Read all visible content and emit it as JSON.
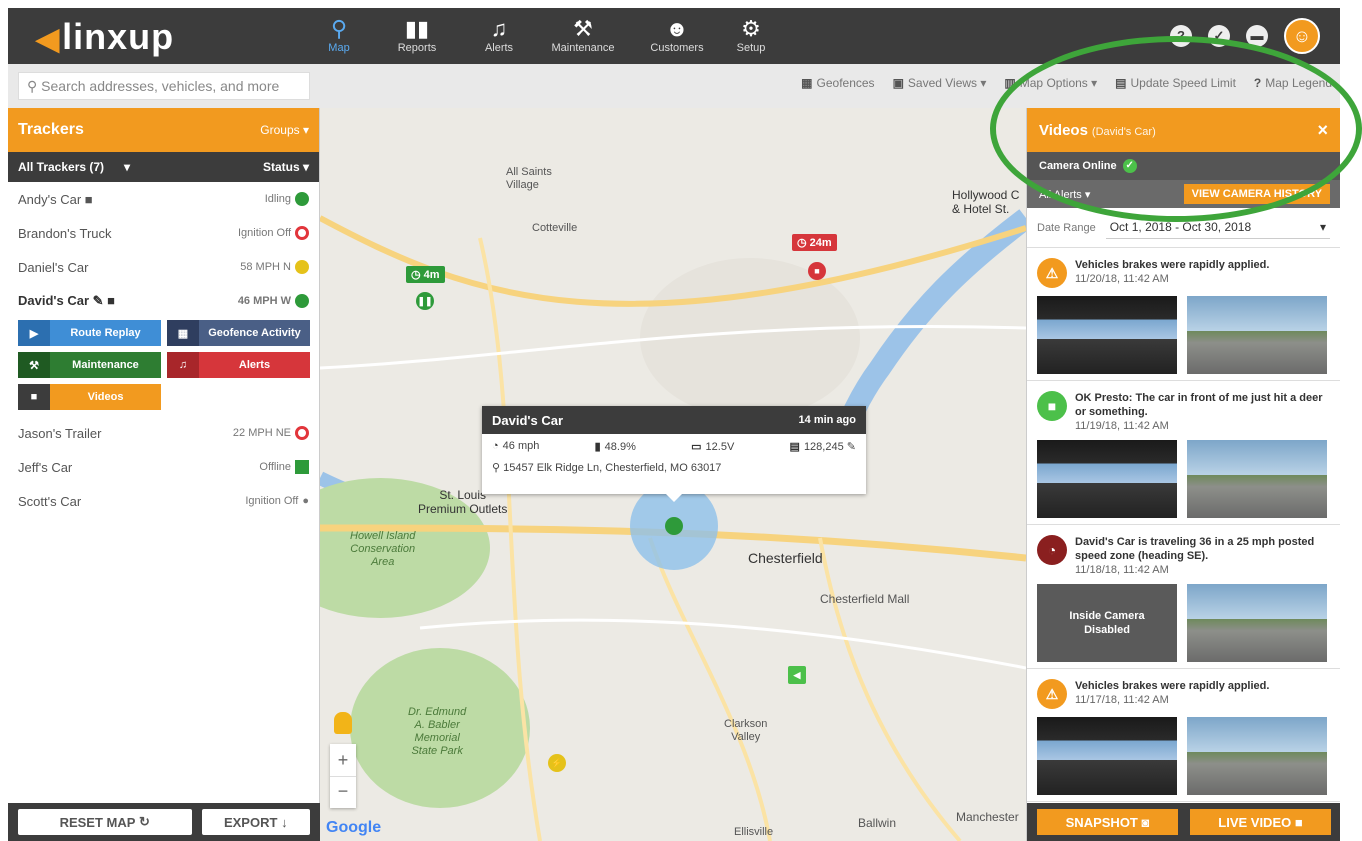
{
  "brand": {
    "name": "linxup"
  },
  "nav": [
    {
      "label": "Map",
      "icon": "map-pin-icon",
      "active": true
    },
    {
      "label": "Reports",
      "icon": "bar-chart-icon"
    },
    {
      "label": "Alerts",
      "icon": "bell-icon"
    },
    {
      "label": "Maintenance",
      "icon": "car-tools-icon"
    },
    {
      "label": "Customers",
      "icon": "people-icon"
    },
    {
      "label": "Setup",
      "icon": "gear-icon"
    }
  ],
  "top_icons": [
    "help-icon",
    "check-icon",
    "chat-icon"
  ],
  "search": {
    "placeholder": "Search addresses, vehicles, and more"
  },
  "tools": {
    "geofences": "Geofences",
    "saved_views": "Saved Views",
    "map_options": "Map Options",
    "update_speed_limit": "Update Speed Limit",
    "map_legend": "Map Legend"
  },
  "trackers": {
    "title": "Trackers",
    "groups_label": "Groups",
    "filter_label": "All Trackers (7)",
    "status_label": "Status",
    "items": [
      {
        "name": "Andy's Car",
        "status": "Idling",
        "state": "green"
      },
      {
        "name": "Brandon's Truck",
        "status": "Ignition Off",
        "state": "red"
      },
      {
        "name": "Daniel's Car",
        "status": "58 MPH N",
        "state": "yellow"
      },
      {
        "name": "David's Car",
        "status": "46 MPH W",
        "state": "green"
      },
      {
        "name": "Jason's Trailer",
        "status": "22 MPH NE",
        "state": "red"
      },
      {
        "name": "Jeff's Car",
        "status": "Offline",
        "state": "square-green"
      },
      {
        "name": "Scott's Car",
        "status": "Ignition Off",
        "state": "black"
      }
    ],
    "actions": {
      "route_replay": "Route Replay",
      "geofence_activity": "Geofence Activity",
      "maintenance": "Maintenance",
      "alerts": "Alerts",
      "videos": "Videos"
    },
    "reset_map": "RESET MAP",
    "export": "EXPORT"
  },
  "map": {
    "labels": {
      "all_saints": "All Saints\nVillage",
      "cotteville": "Cotteville",
      "hollywood": "Hollywood C\n& Hotel St.",
      "premium_outlets": "St. Louis\nPremium Outlets",
      "howell": "Howell Island\nConservation\nArea",
      "chesterfield": "Chesterfield",
      "chesterfield_mall": "Chesterfield Mall",
      "babler": "Dr. Edmund\nA. Babler\nMemorial\nState Park",
      "clarkson": "Clarkson\nValley",
      "ballwin": "Ballwin",
      "manchester": "Manchester",
      "ellisville": "Ellisville",
      "google": "Google"
    },
    "tags": {
      "daniel": "4m",
      "brandon": "24m"
    },
    "popup": {
      "title": "David's Car",
      "time": "14 min ago",
      "speed": "46 mph",
      "fuel": "48.9%",
      "battery": "12.5V",
      "odometer": "128,245",
      "address": "15457 Elk Ridge Ln, Chesterfield, MO 63017"
    }
  },
  "videos": {
    "title": "Videos",
    "subtitle": "(David's Car)",
    "camera_status": "Camera Online",
    "filter": "All Alerts",
    "history_button": "VIEW CAMERA HISTORY",
    "date_label": "Date Range",
    "date_value": "Oct 1, 2018 - Oct 30, 2018",
    "events": [
      {
        "text": "Vehicles brakes were rapidly applied.",
        "date": "11/20/18, 11:42 AM",
        "icon": "warning-icon",
        "color": "orange",
        "disabled": false
      },
      {
        "text": "OK Presto: The car in front of me just hit a deer or something.",
        "date": "11/19/18, 11:42 AM",
        "icon": "camera-icon",
        "color": "green",
        "disabled": false
      },
      {
        "text": "David's Car is traveling 36 in a 25 mph posted speed zone (heading SE).",
        "date": "11/18/18, 11:42 AM",
        "icon": "speedometer-icon",
        "color": "dred",
        "disabled": true
      },
      {
        "text": "Vehicles brakes were rapidly applied.",
        "date": "11/17/18, 11:42 AM",
        "icon": "warning-icon",
        "color": "orange",
        "disabled": false
      }
    ],
    "disabled_text": "Inside Camera\nDisabled",
    "snapshot": "SNAPSHOT",
    "live_video": "LIVE VIDEO"
  },
  "colors": {
    "accent": "#f29a1f",
    "dark": "#3c3c3c",
    "highlight": "#3ea53a"
  }
}
